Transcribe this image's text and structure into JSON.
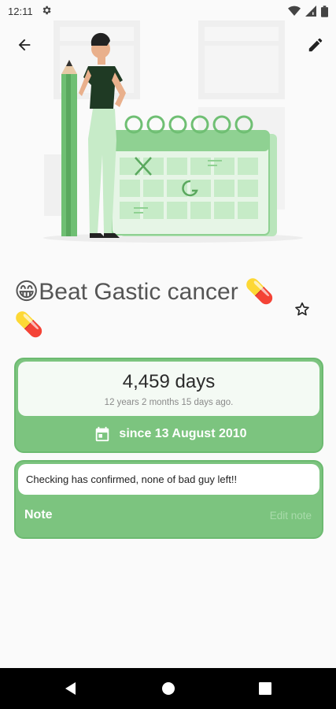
{
  "status_bar": {
    "time": "12:11",
    "icons": [
      "settings-icon",
      "wifi-icon",
      "signal-icon",
      "battery-icon"
    ]
  },
  "app_bar": {
    "back_icon": "arrow-left-icon",
    "edit_icon": "pencil-icon"
  },
  "goal": {
    "title": "😁Beat Gastic cancer 💊💊",
    "favorite_icon": "star-outline-icon"
  },
  "counter": {
    "days": "4,459 days",
    "ago": "12 years 2 months 15 days ago.",
    "since": "since 13 August 2010",
    "calendar_icon": "calendar-icon"
  },
  "note": {
    "text": "Checking has confirmed, none of bad guy left!!",
    "label": "Note",
    "edit_label": "Edit note"
  },
  "colors": {
    "accent": "#7cc47f",
    "accent_border": "#6cba70",
    "edit_note_text": "#a9dbab"
  }
}
